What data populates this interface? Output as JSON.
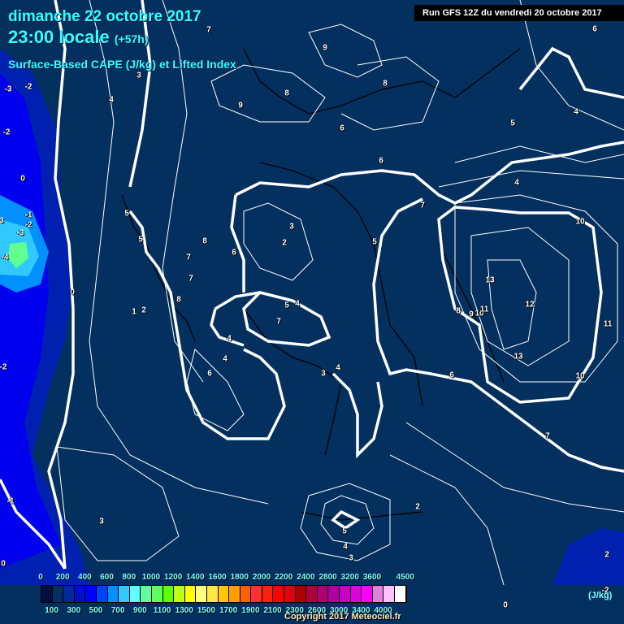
{
  "header": {
    "date": "dimanche 22 octobre 2017",
    "time": "23:00 locale",
    "lead": "(+57h)",
    "product": "Surface-Based CAPE (J/kg) et Lifted Index",
    "run": "Run GFS 12Z du vendredi 20 octobre 2017"
  },
  "contour_labels": [
    "7",
    "9",
    "6",
    "-3",
    "-2",
    "3",
    "4",
    "8",
    "8",
    "9",
    "6",
    "5",
    "4",
    "-2",
    "6",
    "4",
    "0",
    "7",
    "10",
    "5",
    "3",
    "-1",
    "3",
    "-2",
    "-3",
    "5",
    "8",
    "2",
    "5",
    "-4",
    "7",
    "6",
    "7",
    "13",
    "0",
    "8",
    "5",
    "4",
    "12",
    "1",
    "2",
    "8",
    "9",
    "10",
    "11",
    "7",
    "11",
    "4",
    "4",
    "13",
    "-2",
    "6",
    "3",
    "4",
    "6",
    "10",
    "7",
    "-1",
    "2",
    "3",
    "5",
    "4",
    "3",
    "0",
    "2",
    "-2",
    "0"
  ],
  "legend": {
    "colors": [
      "#001040",
      "#00306a",
      "#002a9a",
      "#0010cc",
      "#0000ff",
      "#0040ff",
      "#0090ff",
      "#30c8ff",
      "#60ffff",
      "#60ffa0",
      "#60ff60",
      "#60ff00",
      "#c0ff10",
      "#ffff00",
      "#ffff80",
      "#ffe840",
      "#ffc800",
      "#ffa000",
      "#ff6000",
      "#ff3030",
      "#ff2010",
      "#ff0000",
      "#e00010",
      "#b00000",
      "#b00040",
      "#b00070",
      "#b000a0",
      "#c800c8",
      "#e000e0",
      "#ff00ff",
      "#e080e0",
      "#ffc0ff",
      "#ffffff"
    ],
    "top_labels": [
      "0",
      "200",
      "400",
      "600",
      "800",
      "1000",
      "1200",
      "1400",
      "1600",
      "1800",
      "2000",
      "2200",
      "2400",
      "2800",
      "3200",
      "3600",
      "4500"
    ],
    "bottom_labels": [
      "100",
      "300",
      "500",
      "700",
      "900",
      "1100",
      "1300",
      "1500",
      "1700",
      "1900",
      "2100",
      "2300",
      "2600",
      "3000",
      "3400",
      "4000"
    ],
    "unit": "(J/kg)"
  },
  "copyright": "Copyright 2017 Meteociel.fr"
}
